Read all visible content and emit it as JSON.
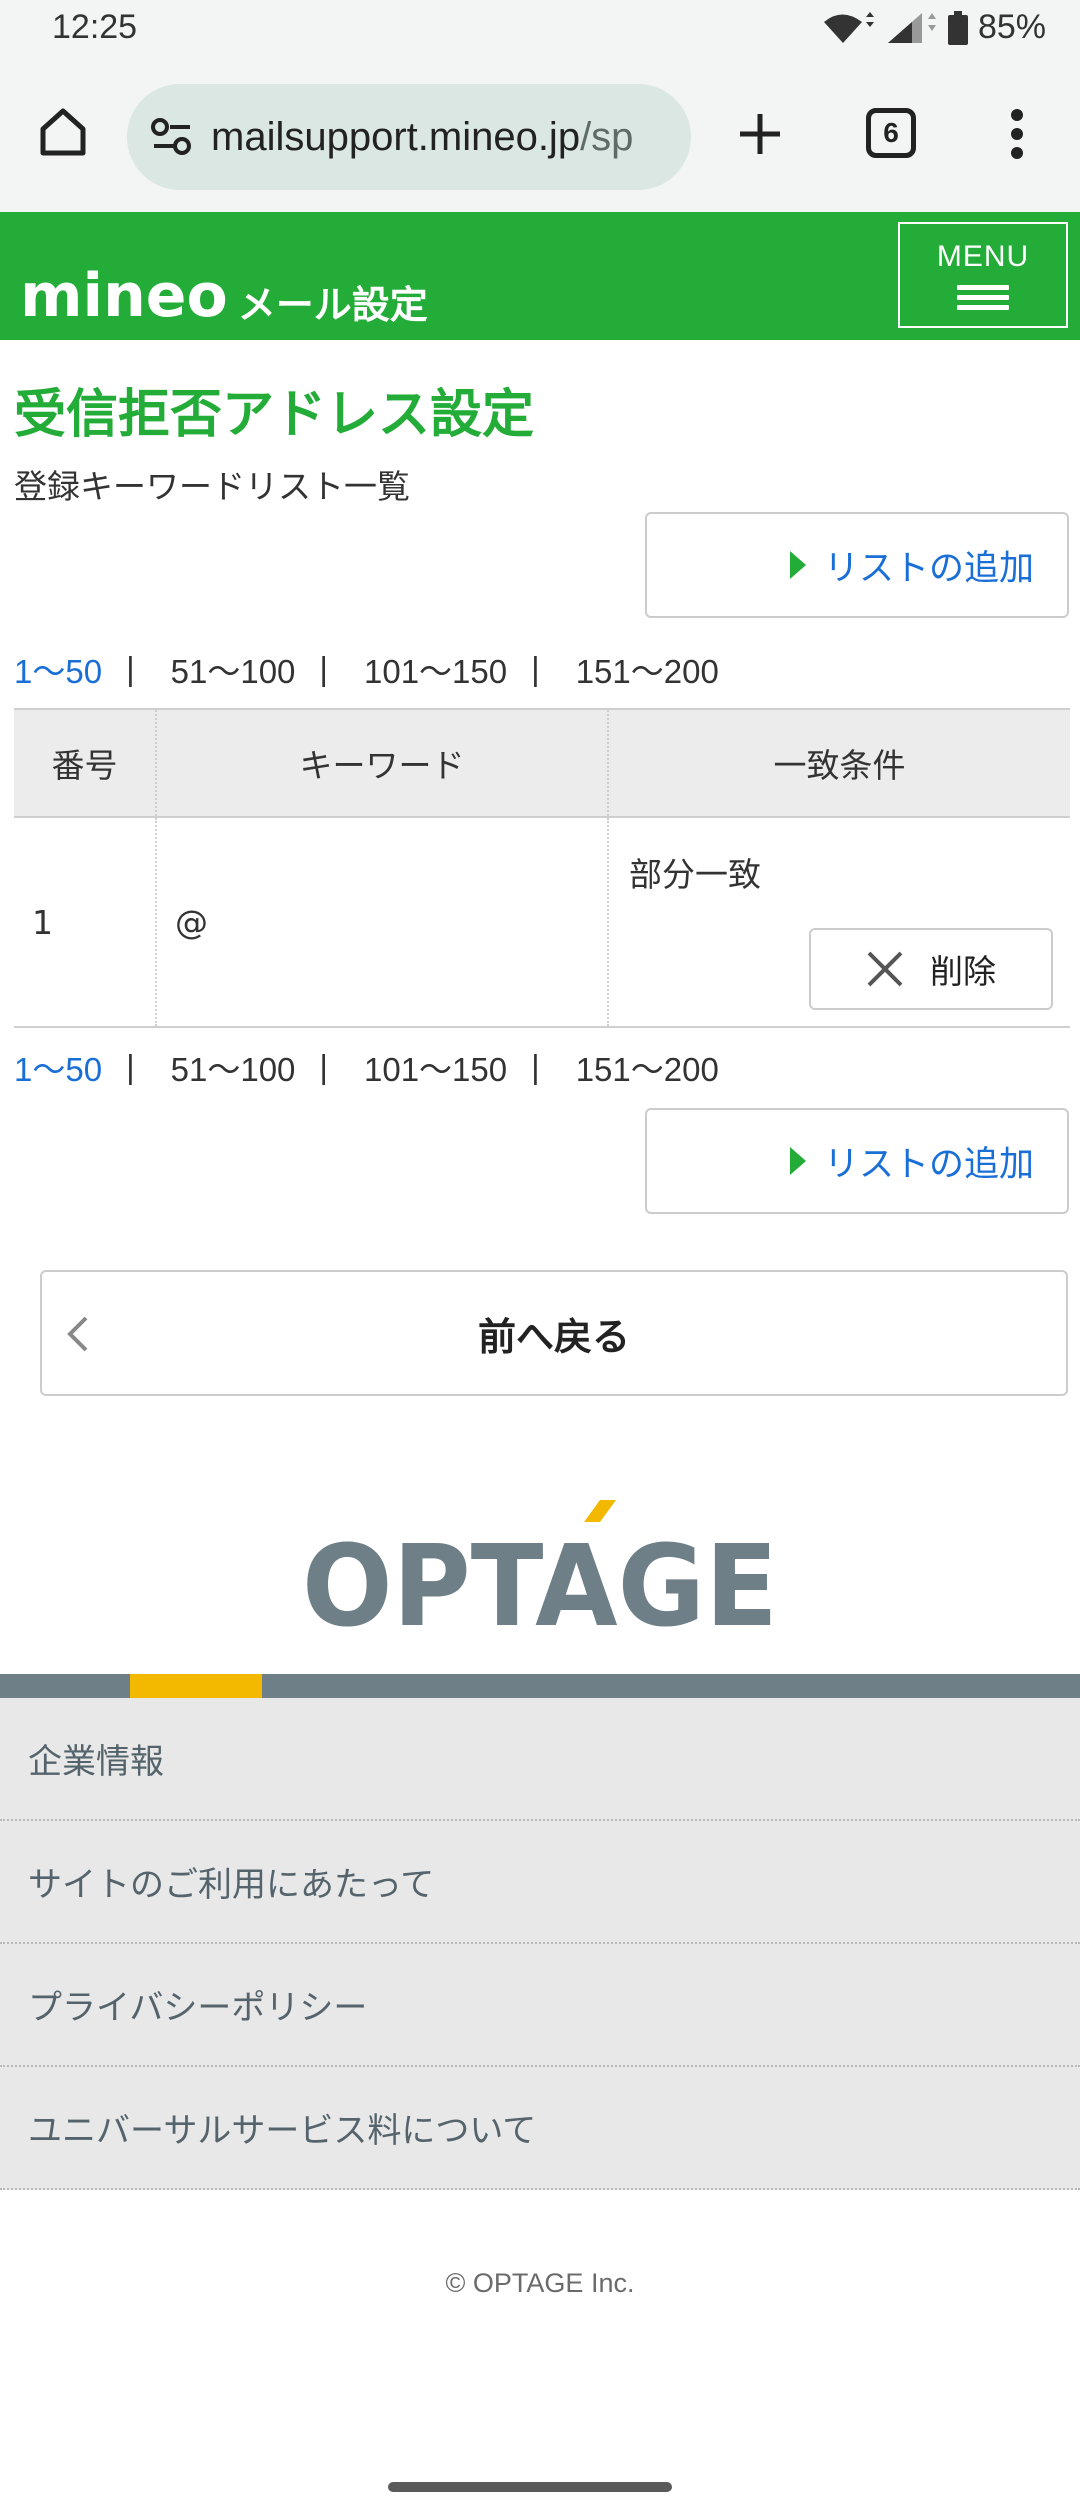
{
  "status": {
    "time": "12:25",
    "battery": "85%"
  },
  "browser": {
    "url_main": "mailsupport.mineo.jp",
    "url_path": "/sp",
    "tab_count": "6"
  },
  "header": {
    "logo_text": "mineo",
    "logo_sub": "メール設定",
    "menu_label": "MENU",
    "brand_color": "#23ac38"
  },
  "page": {
    "title": "受信拒否アドレス設定",
    "subtitle": "登録キーワードリスト一覧",
    "add_button": "リストの追加"
  },
  "pagination": {
    "pages": [
      "1〜50",
      "51〜100",
      "101〜150",
      "151〜200"
    ],
    "active_index": 0
  },
  "table": {
    "headers": [
      "番号",
      "キーワード",
      "一致条件"
    ],
    "rows": [
      {
        "num": "1",
        "keyword": "@",
        "condition": "部分一致",
        "delete_label": "削除"
      }
    ]
  },
  "back_button": "前へ戻る",
  "footer": {
    "company_logo": "OPTAGE",
    "links": [
      "企業情報",
      "サイトのご利用にあたって",
      "プライバシーポリシー",
      "ユニバーサルサービス料について"
    ],
    "copyright": "© OPTAGE Inc."
  }
}
